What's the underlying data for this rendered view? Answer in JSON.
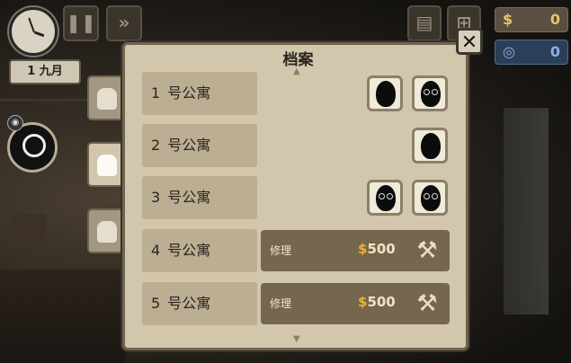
{
  "hud": {
    "date_label": "1 九月",
    "pause_icon": "pause-icon",
    "fast_forward_icon": "fast-forward-icon",
    "currency_symbol": "$",
    "money": "0",
    "blue_symbol": "◎",
    "blue_value": "0"
  },
  "dialog": {
    "title": "档案",
    "close_label": "✕",
    "tabs": [
      "tab-tenant-profile",
      "tab-residents",
      "tab-apartment"
    ],
    "rows": [
      {
        "num": "1",
        "label": "号公寓",
        "tenants": 2,
        "repair": false
      },
      {
        "num": "2",
        "label": "号公寓",
        "tenants": 1,
        "repair": false
      },
      {
        "num": "3",
        "label": "号公寓",
        "tenants": 2,
        "repair": false
      },
      {
        "num": "4",
        "label": "号公寓",
        "tenants": 0,
        "repair": true,
        "repair_label": "修理",
        "cost_symbol": "$",
        "cost": "500"
      },
      {
        "num": "5",
        "label": "号公寓",
        "tenants": 0,
        "repair": true,
        "repair_label": "修理",
        "cost_symbol": "$",
        "cost": "500"
      }
    ]
  },
  "colors": {
    "panel": "#d2c6ac",
    "row_bg": "#bbae92",
    "repair_bg": "#75664f",
    "money": "#e6c46a"
  }
}
